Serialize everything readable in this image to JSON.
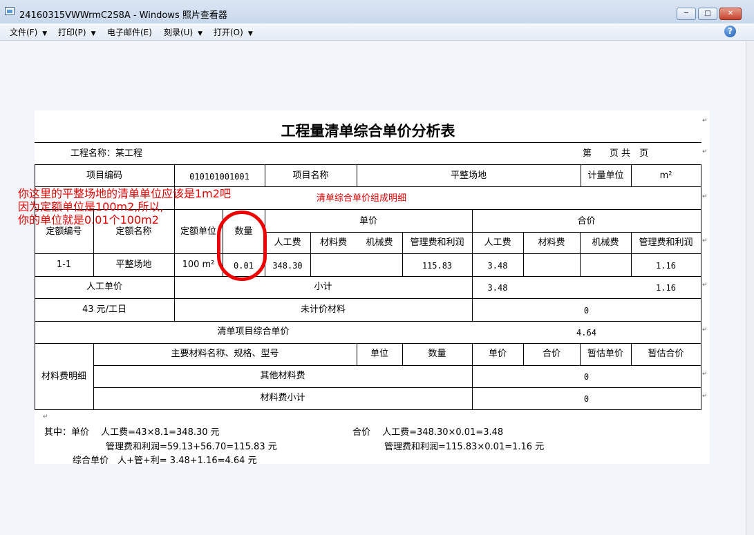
{
  "window": {
    "title": "24160315VWWrmC2S8A - Windows 照片查看器",
    "min_label": "─",
    "max_label": "□",
    "close_label": "✕"
  },
  "menu": [
    {
      "label": "文件(F)",
      "has_dropdown": true
    },
    {
      "label": "打印(P)",
      "has_dropdown": true
    },
    {
      "label": "电子邮件(E)",
      "has_dropdown": false
    },
    {
      "label": "刻录(U)",
      "has_dropdown": true
    },
    {
      "label": "打开(O)",
      "has_dropdown": true
    }
  ],
  "help_label": "?",
  "doc": {
    "title": "工程量清单综合单价分析表",
    "project_line": "工程名称：某工程",
    "page_line": "第　　页 共　页",
    "row_project": {
      "code_label": "项目编码",
      "code_value": "010101001001",
      "name_label": "项目名称",
      "name_value": "平整场地",
      "unit_label": "计量单位",
      "unit_value": "m²"
    },
    "section_title": "清单综合单价组成明细",
    "headers": {
      "quota_code": "定额编号",
      "quota_name": "定额名称",
      "quota_unit": "定额单位",
      "qty": "数量",
      "unit_price": "单价",
      "total_price": "合价",
      "cols": [
        "人工费",
        "材料费",
        "机械费",
        "管理费和利润",
        "人工费",
        "材料费",
        "机械费",
        "管理费和利润"
      ]
    },
    "item_row": {
      "code": "1-1",
      "name": "平整场地",
      "unit": "100 m²",
      "qty": "0.01",
      "labor": "348.30",
      "material": "",
      "machine": "",
      "mgmt": "115.83",
      "t_labor": "3.48",
      "t_material": "",
      "t_machine": "",
      "t_mgmt": "1.16"
    },
    "labor_rate_label": "人工单价",
    "labor_rate_value": "43 元/工日",
    "subtotal_label": "小计",
    "subtotal": {
      "labor": "3.48",
      "mgmt": "1.16"
    },
    "unpriced_label": "未计价材料",
    "unpriced_value": "0",
    "comprehensive_label": "清单项目综合单价",
    "comprehensive_value": "4.64",
    "material_detail_label": "材料费明细",
    "material_headers": [
      "主要材料名称、规格、型号",
      "单位",
      "数量",
      "单价",
      "合价",
      "暂估单价",
      "暂估合价"
    ],
    "other_material_label": "其他材料费",
    "other_material_value": "0",
    "material_subtotal_label": "材料费小计",
    "material_subtotal_value": "0",
    "notes": {
      "l1a": "其中：单价　 人工费=43×8.1=348.30 元",
      "l1b": "合价　 人工费=348.30×0.01=3.48",
      "l2a": "管理费和利润=59.13+56.70=115.83 元",
      "l2b": "管理费和利润=115.83×0.01=1.16 元",
      "l3": "综合单价　人+管+利= 3.48+1.16=4.64 元"
    }
  },
  "annotation": {
    "lines": [
      "你这里的平整场地的清单单位应该是1m2吧",
      "因为定额单位是100m2,所以,",
      "你的单位就是0.01个100m2"
    ],
    "color": "#e00000"
  },
  "colors": {
    "title_bar": "#c8d8ec",
    "menu_bar": "#e3ebf6",
    "viewer_bg": "#f2f5fa",
    "close": "#c7432c"
  }
}
